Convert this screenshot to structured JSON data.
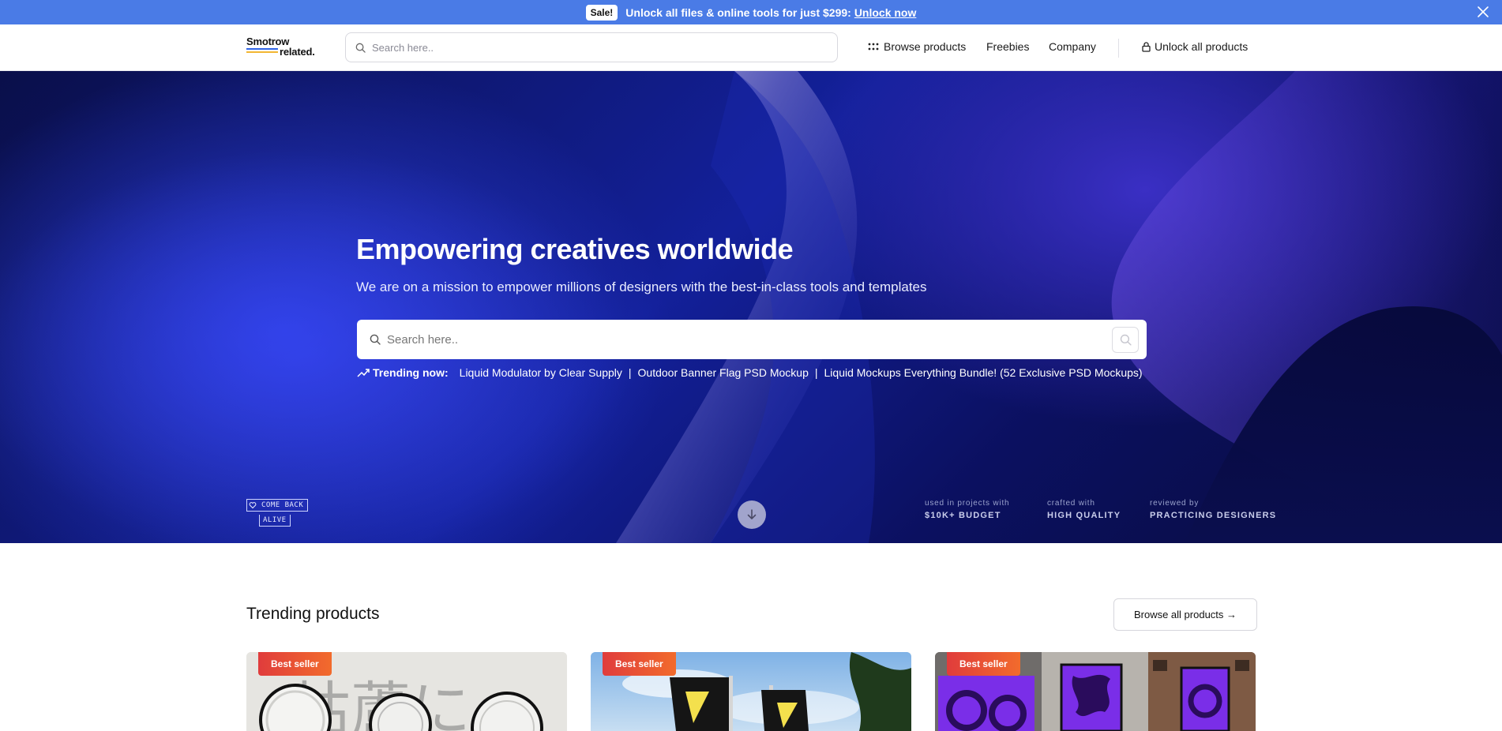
{
  "sale_bar": {
    "badge": "Sale!",
    "text": "Unlock all files & online tools for just $299:",
    "link": "Unlock now"
  },
  "nav": {
    "logo_top": "Smotrow",
    "logo_bottom": "related.",
    "search_placeholder": "Search here..",
    "browse_products": "Browse products",
    "freebies": "Freebies",
    "company": "Company",
    "unlock_all": "Unlock all products"
  },
  "hero": {
    "title": "Empowering creatives worldwide",
    "subtitle": "We are on a mission to empower millions of designers with the best-in-class tools and templates",
    "search_placeholder": "Search here..",
    "trending_label": "Trending now:",
    "trending_items": [
      "Liquid Modulator by Clear Supply",
      "Outdoor Banner Flag PSD Mockup",
      "Liquid Mockups Everything Bundle! (52 Exclusive PSD Mockups)"
    ],
    "separator": "|",
    "come_back_line1": "COME BACK",
    "come_back_line2": "ALIVE",
    "stats": [
      {
        "key": "used in projects with",
        "value": "$10K+ BUDGET"
      },
      {
        "key": "crafted with",
        "value": "HIGH QUALITY"
      },
      {
        "key": "reviewed by",
        "value": "PRACTICING DESIGNERS"
      }
    ]
  },
  "trending_products": {
    "title": "Trending products",
    "browse_all": "Browse all products →",
    "cards": [
      {
        "badge": "Best seller"
      },
      {
        "badge": "Best seller"
      },
      {
        "badge": "Best seller"
      }
    ]
  },
  "colors": {
    "sale_bar": "#4a7be6",
    "badge_start": "#e03c3c",
    "badge_end": "#f26b2c"
  },
  "icons": [
    "close-icon",
    "search-icon",
    "grid-dots-icon",
    "lock-icon",
    "trending-up-icon",
    "heart-icon",
    "arrow-down-icon"
  ]
}
